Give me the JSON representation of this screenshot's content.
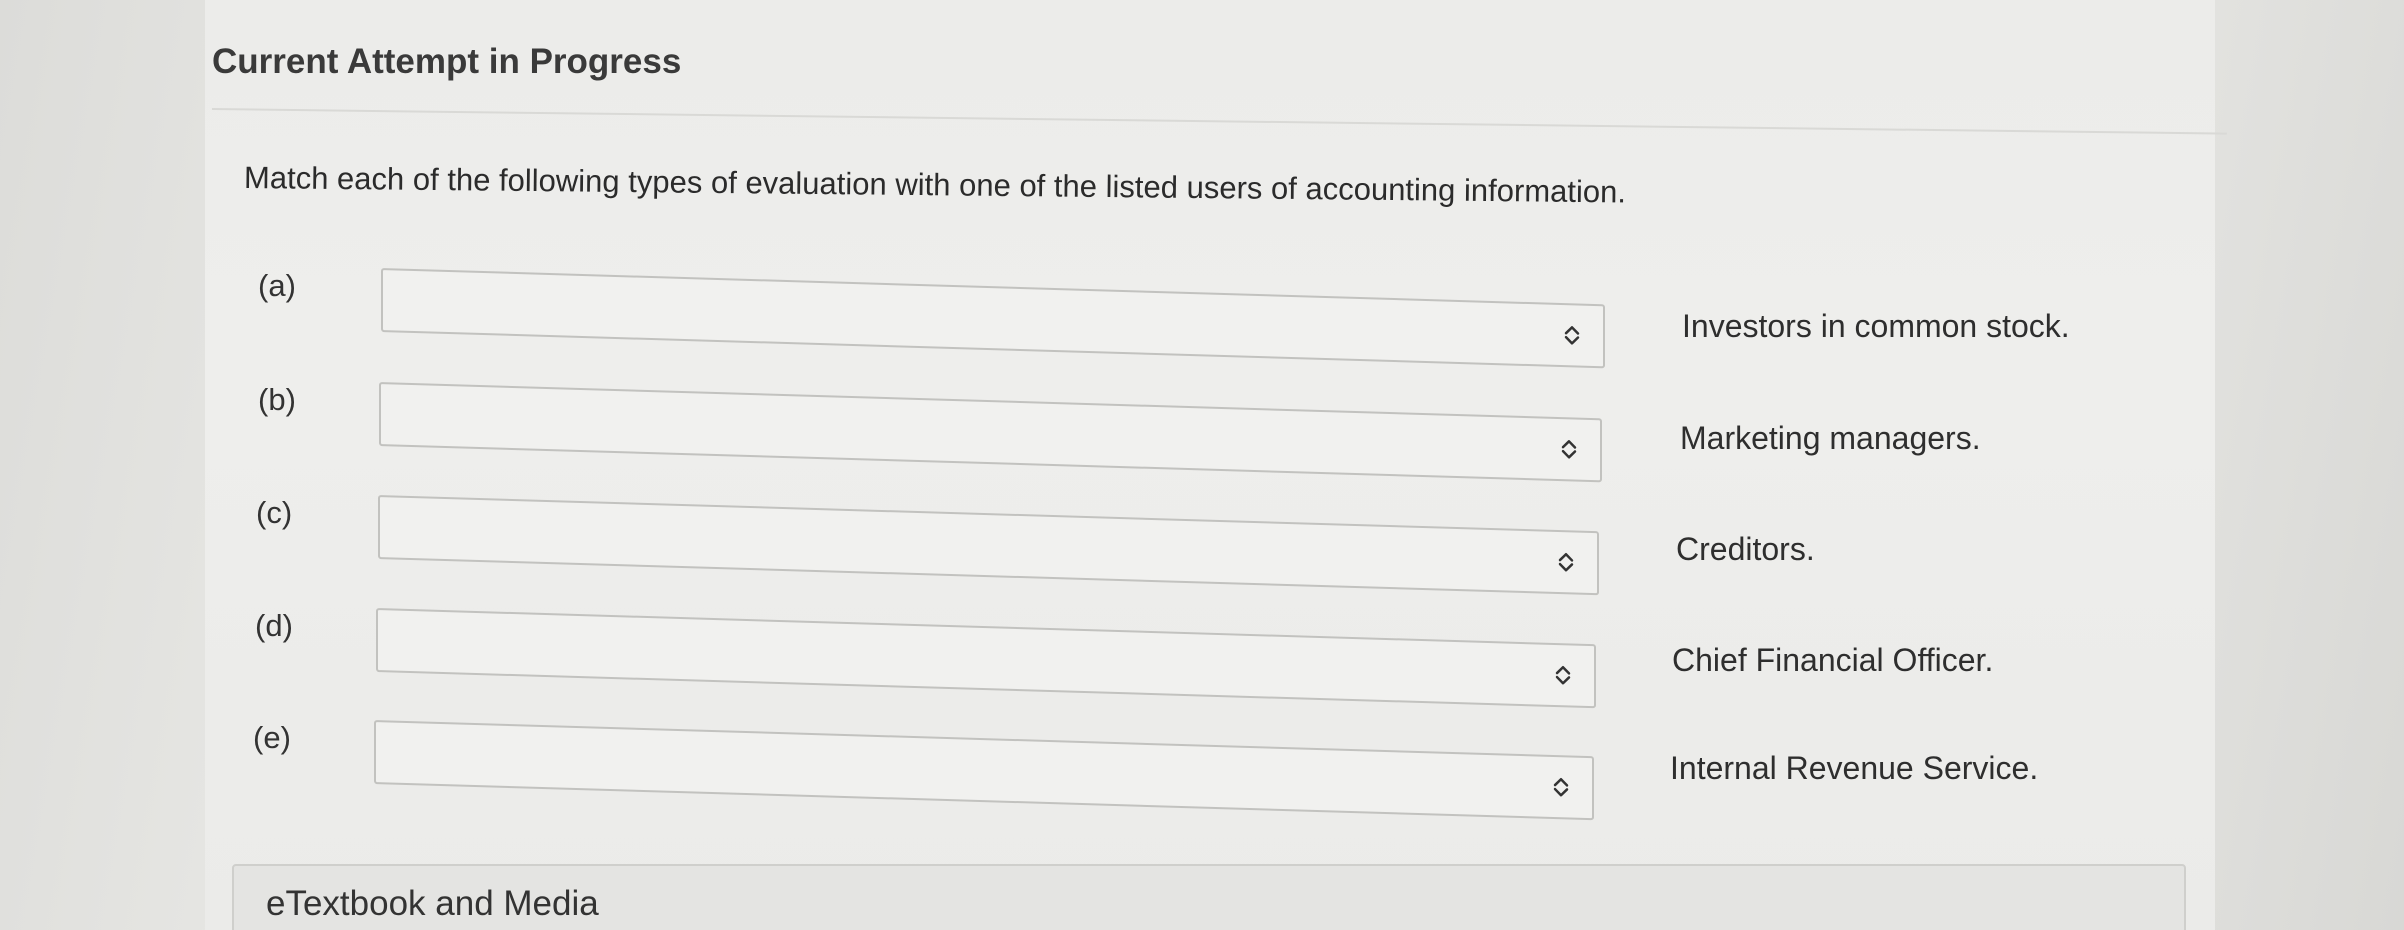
{
  "header": {
    "title": "Current Attempt in Progress"
  },
  "question": {
    "prompt": "Match each of the following types of evaluation with one of the listed users of accounting information."
  },
  "matches": [
    {
      "label": "(a)",
      "selected": "",
      "answer": "Investors in common stock."
    },
    {
      "label": "(b)",
      "selected": "",
      "answer": "Marketing managers."
    },
    {
      "label": "(c)",
      "selected": "",
      "answer": "Creditors."
    },
    {
      "label": "(d)",
      "selected": "",
      "answer": "Chief Financial Officer."
    },
    {
      "label": "(e)",
      "selected": "",
      "answer": "Internal Revenue Service."
    }
  ],
  "media": {
    "label": "eTextbook and Media"
  },
  "icons": {
    "select": "updown-chevron-icon"
  }
}
